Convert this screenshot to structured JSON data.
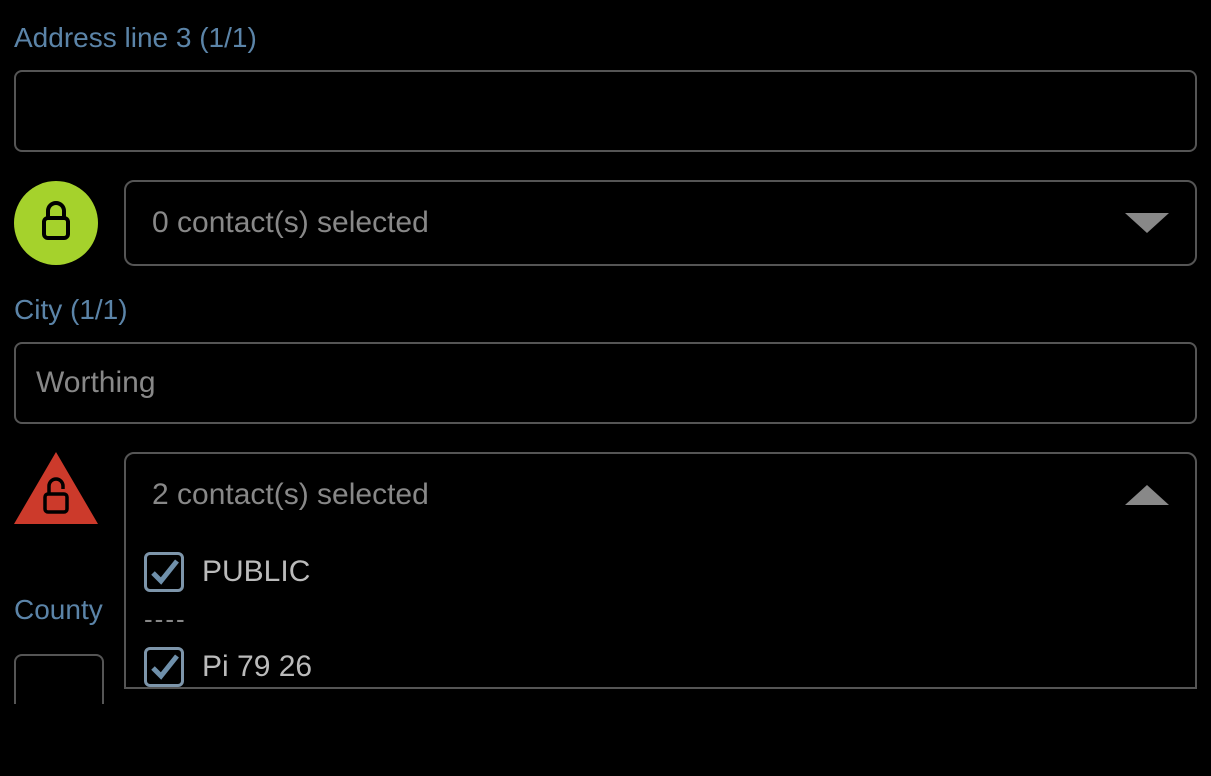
{
  "address3": {
    "label": "Address line 3 (1/1)",
    "value": ""
  },
  "address3_contacts": {
    "text": "0 contact(s) selected"
  },
  "city": {
    "label": "City (1/1)",
    "value": "Worthing"
  },
  "city_contacts": {
    "text": "2 contact(s) selected",
    "options": {
      "public": "PUBLIC",
      "divider": "----",
      "second": "Pi 79 26"
    }
  },
  "county": {
    "label": "County"
  }
}
